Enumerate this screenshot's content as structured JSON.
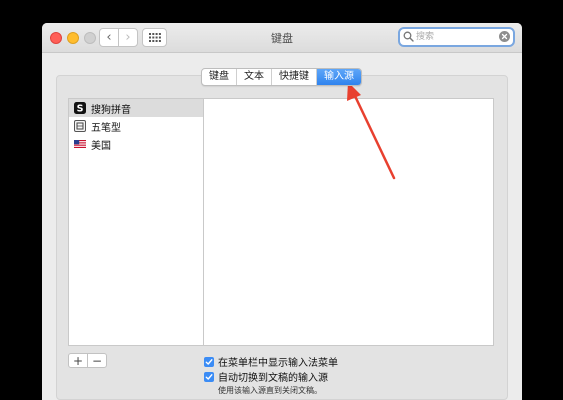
{
  "window": {
    "title": "键盘",
    "nav_back": "‹",
    "nav_forward": "›",
    "search_placeholder": "搜索"
  },
  "tabs": [
    {
      "label": "键盘",
      "active": false
    },
    {
      "label": "文本",
      "active": false
    },
    {
      "label": "快捷键",
      "active": false
    },
    {
      "label": "输入源",
      "active": true
    }
  ],
  "input_sources": [
    {
      "label": "搜狗拼音",
      "icon": "sogou-icon",
      "selected": true
    },
    {
      "label": "五笔型",
      "icon": "wubi-icon",
      "selected": false
    },
    {
      "label": "美国",
      "icon": "us-flag-icon",
      "selected": false
    }
  ],
  "list_controls": {
    "add": "+",
    "remove": "−"
  },
  "options": {
    "show_menu": {
      "label": "在菜单栏中显示输入法菜单",
      "checked": true
    },
    "auto_switch": {
      "label": "自动切换到文稿的输入源",
      "checked": true
    },
    "note": "使用该输入源直到关闭文稿。"
  },
  "colors": {
    "accent": "#3b8cf5",
    "annotation_arrow": "#e8402f",
    "close": "#ff5f57",
    "minimize": "#ffbd2e"
  }
}
